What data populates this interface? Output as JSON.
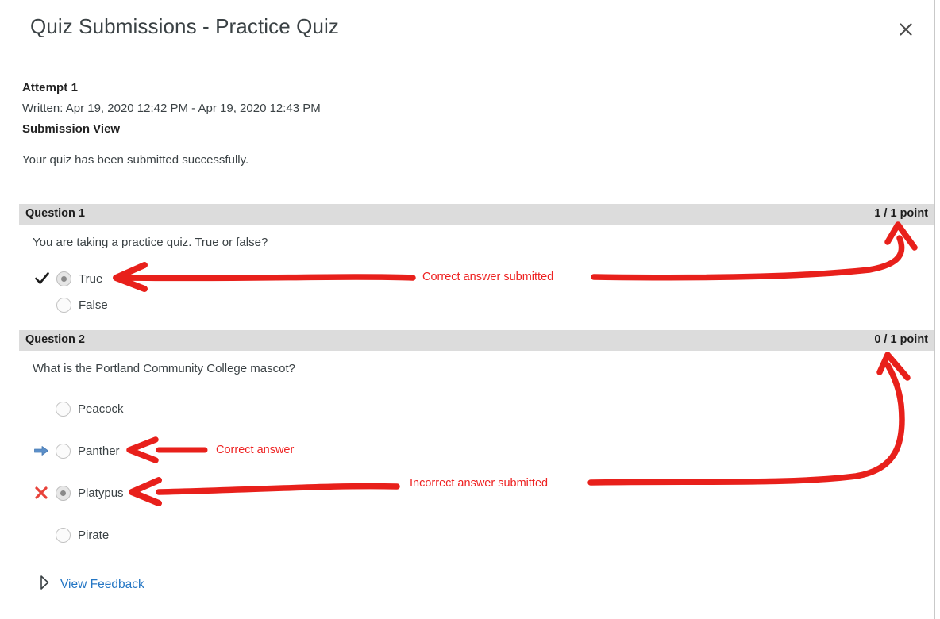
{
  "dialog": {
    "title": "Quiz Submissions - Practice Quiz",
    "close_icon": "close-icon"
  },
  "attempt": {
    "heading": "Attempt 1",
    "written": "Written: Apr 19, 2020 12:42 PM - Apr 19, 2020 12:43 PM",
    "submission_view": "Submission View",
    "status_message": "Your quiz has been submitted successfully."
  },
  "questions": [
    {
      "label": "Question 1",
      "points": "1 / 1 point",
      "text": "You are taking a practice quiz. True or false?",
      "options": [
        {
          "label": "True",
          "selected": true,
          "marker": "check-icon"
        },
        {
          "label": "False",
          "selected": false,
          "marker": "none"
        }
      ]
    },
    {
      "label": "Question 2",
      "points": "0 / 1 point",
      "text": "What is the Portland Community College mascot?",
      "options": [
        {
          "label": "Peacock",
          "selected": false,
          "marker": "none"
        },
        {
          "label": "Panther",
          "selected": false,
          "marker": "arrow-right-icon"
        },
        {
          "label": "Platypus",
          "selected": true,
          "marker": "x-icon"
        },
        {
          "label": "Pirate",
          "selected": false,
          "marker": "none"
        }
      ]
    }
  ],
  "feedback_link": {
    "label": "View Feedback",
    "icon": "triangle-right-icon"
  },
  "annotations": [
    {
      "text": "Correct answer submitted"
    },
    {
      "text": "Correct answer"
    },
    {
      "text": "Incorrect answer submitted"
    }
  ],
  "colors": {
    "annotation_red": "#ee2222",
    "link_blue": "#2476c4",
    "question_bar_gray": "#dcdcdc",
    "arrow_blue": "#5b8fc9",
    "x_red": "#e8423a"
  }
}
